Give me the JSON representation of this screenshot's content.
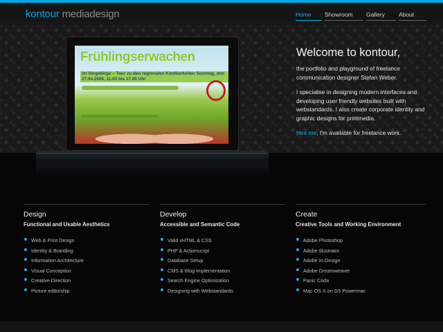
{
  "logo": {
    "part1": "kontour",
    "part2": " mediadesign"
  },
  "nav": [
    {
      "label": "Home",
      "active": true
    },
    {
      "label": "Showroom",
      "active": false
    },
    {
      "label": "Gallery",
      "active": false
    },
    {
      "label": "About",
      "active": false
    }
  ],
  "colors": {
    "accent": "#00a6e0",
    "background": "#060606",
    "text": "#e6e6e6"
  },
  "screen_poster": {
    "title": "Frühlingserwachen",
    "subtitle": "im Vorgebirge – Tour zu den regionalen Kostbarkeiten Sonntag, den 27.04.2008, 11.00 bis 17.00 Uhr"
  },
  "intro": {
    "heading": "Welcome to kontour,",
    "p1": "the portfolio and playground of freelance communication designer Stefan Weber.",
    "p2": "I specialise in designing modern interfaces and developing user friendly websites built with webstandards. I also create corporate identity and graphic designs for printmedia.",
    "hire_link": "Hire me",
    "hire_rest": ", I'm available for freelance work."
  },
  "columns": [
    {
      "title": "Design",
      "subtitle": "Functional and Usable Aesthetics",
      "items": [
        "Web & Print Design",
        "Identity & Branding",
        "Information Architecture",
        "Visual Conception",
        "Creative Direction",
        "Picture editorship"
      ]
    },
    {
      "title": "Develop",
      "subtitle": "Accessible and Semantic Code",
      "items": [
        "Valid xHTML & CSS",
        "PHP & Actionscript",
        "Database Setup",
        "CMS & Blog Implementation",
        "Search Engine Optimization",
        "Designing with Webstandards"
      ]
    },
    {
      "title": "Create",
      "subtitle": "Creative Tools and Working Environment",
      "items": [
        "Adobe Photoshop",
        "Adobe Illustrator",
        "Adobe In-Design",
        "Adobe Dreamweaver",
        "Panic Coda",
        "Mac OS X on G5 Powermac"
      ]
    }
  ]
}
